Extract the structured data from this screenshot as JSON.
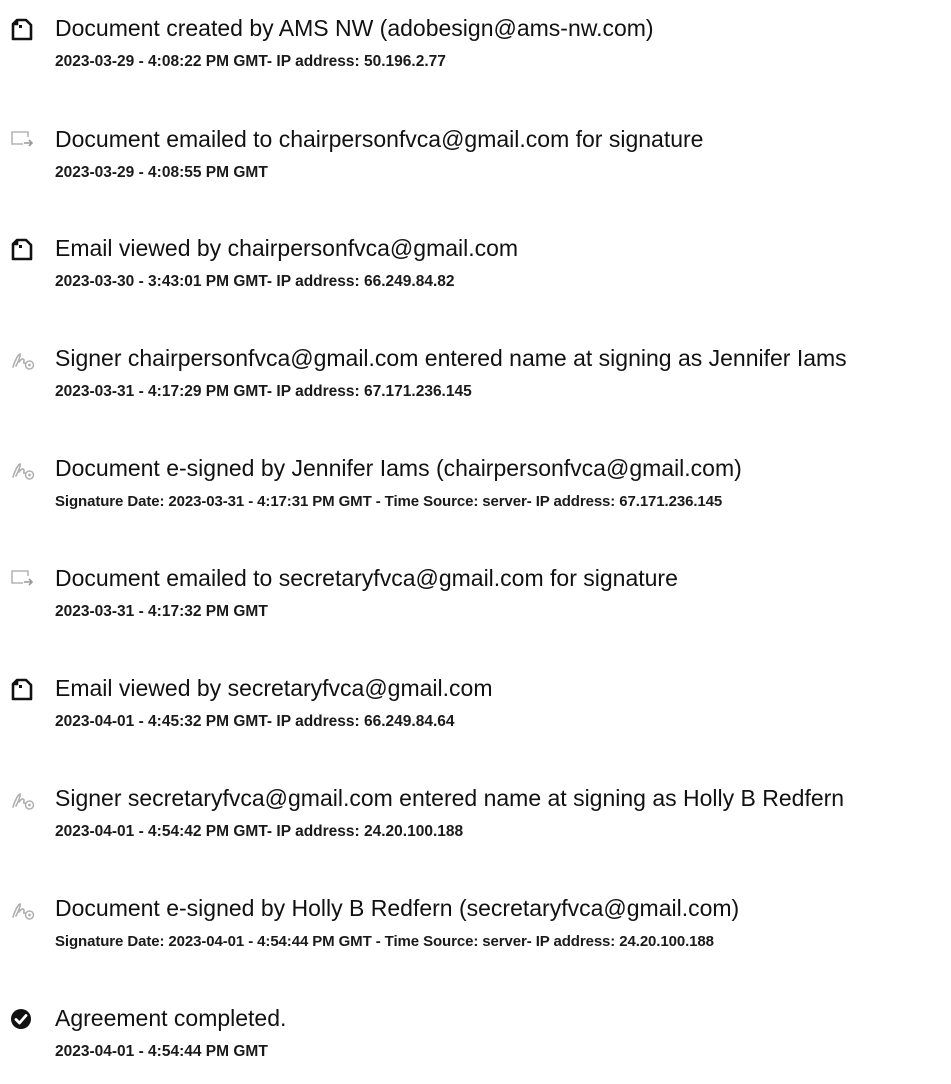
{
  "events": [
    {
      "icon": "document-icon",
      "title": "Document created by AMS NW (adobesign@ams-nw.com)",
      "detail": "2023-03-29 - 4:08:22 PM GMT- IP address: 50.196.2.77"
    },
    {
      "icon": "email-sent-icon",
      "title": "Document emailed to chairpersonfvca@gmail.com for signature",
      "detail": "2023-03-29 - 4:08:55 PM GMT"
    },
    {
      "icon": "document-icon",
      "title": "Email viewed by chairpersonfvca@gmail.com",
      "detail": "2023-03-30 - 3:43:01 PM GMT- IP address: 66.249.84.82"
    },
    {
      "icon": "signature-icon",
      "title": "Signer chairpersonfvca@gmail.com entered name at signing as Jennifer Iams",
      "detail": "2023-03-31 - 4:17:29 PM GMT- IP address: 67.171.236.145"
    },
    {
      "icon": "signature-icon",
      "title": "Document e-signed by Jennifer Iams (chairpersonfvca@gmail.com)",
      "detail": "Signature Date: 2023-03-31 - 4:17:31 PM GMT - Time Source: server- IP address: 67.171.236.145"
    },
    {
      "icon": "email-sent-icon",
      "title": "Document emailed to secretaryfvca@gmail.com for signature",
      "detail": "2023-03-31 - 4:17:32 PM GMT"
    },
    {
      "icon": "document-icon",
      "title": "Email viewed by secretaryfvca@gmail.com",
      "detail": "2023-04-01 - 4:45:32 PM GMT- IP address: 66.249.84.64"
    },
    {
      "icon": "signature-icon",
      "title": "Signer secretaryfvca@gmail.com entered name at signing as Holly B Redfern",
      "detail": "2023-04-01 - 4:54:42 PM GMT- IP address: 24.20.100.188"
    },
    {
      "icon": "signature-icon",
      "title": "Document e-signed by Holly B Redfern (secretaryfvca@gmail.com)",
      "detail": "Signature Date: 2023-04-01 - 4:54:44 PM GMT - Time Source: server- IP address: 24.20.100.188"
    },
    {
      "icon": "check-circle-icon",
      "title": "Agreement completed.",
      "detail": "2023-04-01 - 4:54:44 PM GMT"
    }
  ]
}
